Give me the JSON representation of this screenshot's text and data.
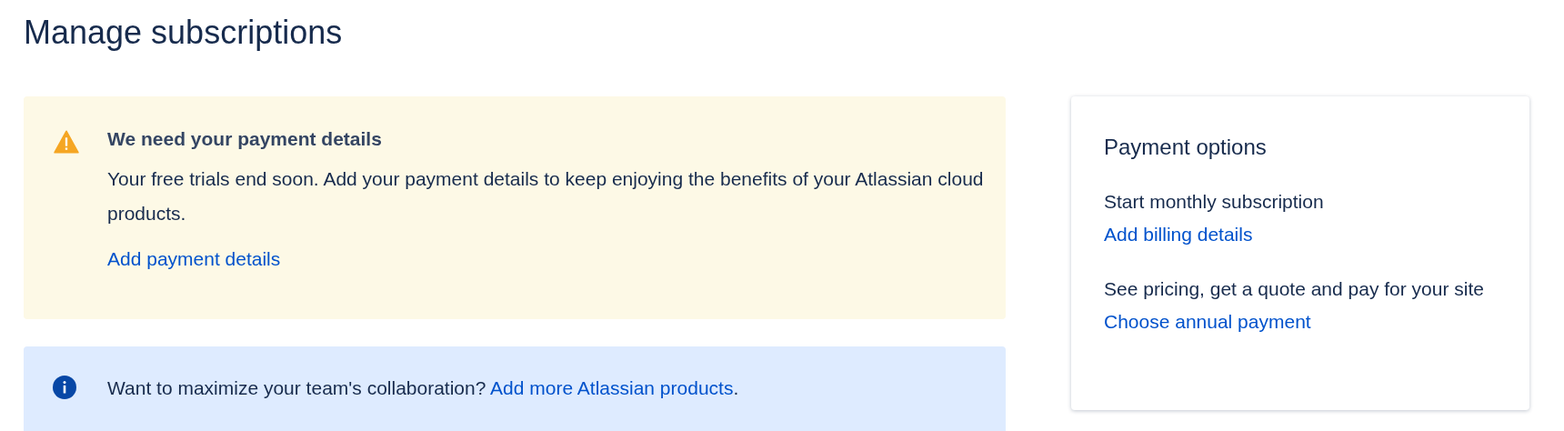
{
  "page_title": "Manage subscriptions",
  "warning": {
    "title": "We need your payment details",
    "message": "Your free trials end soon. Add your payment details to keep enjoying the benefits of your Atlassian cloud products.",
    "link": "Add payment details"
  },
  "info": {
    "message": "Want to maximize your team's collaboration?",
    "link": "Add more Atlassian products",
    "suffix": "."
  },
  "payment_options": {
    "title": "Payment options",
    "items": [
      {
        "text": "Start monthly subscription",
        "link": "Add billing details"
      },
      {
        "text": "See pricing, get a quote and pay for your site",
        "link": "Choose annual payment"
      }
    ]
  }
}
